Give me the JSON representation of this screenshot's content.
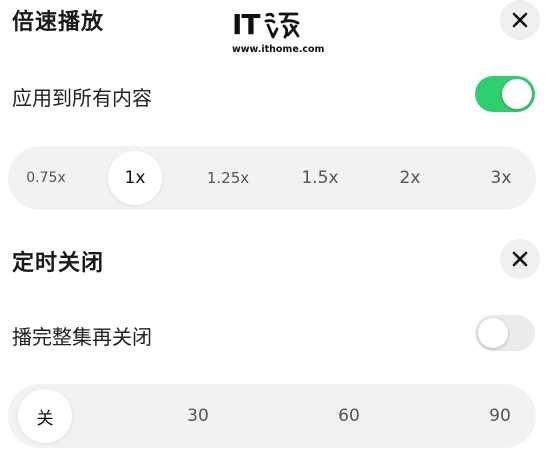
{
  "speed_section": {
    "title": "倍速播放",
    "apply_all_label": "应用到所有内容",
    "apply_all_on": true,
    "options": [
      "0.75x",
      "1x",
      "1.25x",
      "1.5x",
      "2x",
      "3x"
    ],
    "selected": "1x"
  },
  "timer_section": {
    "title": "定时关闭",
    "after_episode_label": "播完整集再关闭",
    "after_episode_on": false,
    "options": [
      "关",
      "30",
      "60",
      "90"
    ],
    "selected": "关"
  },
  "watermark": {
    "brand": "IT",
    "url": "www.ithome.com"
  },
  "colors": {
    "toggle_on": "#2fcf6f",
    "toggle_off": "#ebebeb",
    "pill_bg": "#f2f2f2"
  },
  "icons": {
    "close": "close-icon"
  }
}
